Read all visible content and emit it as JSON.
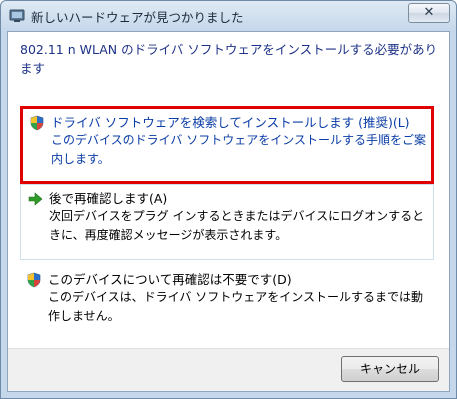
{
  "window": {
    "title": "新しいハードウェアが見つかりました",
    "close_label": "✕"
  },
  "instruction": "802.11 n WLAN のドライバ ソフトウェアをインストールする必要があります",
  "options": [
    {
      "title": "ドライバ ソフトウェアを検索してインストールします (推奨)(L)",
      "description": "このデバイスのドライバ ソフトウェアをインストールする手順をご案内します。",
      "icon": "shield-icon"
    },
    {
      "title": "後で再確認します(A)",
      "description": "次回デバイスをプラグ インするときまたはデバイスにログオンするときに、再度確認メッセージが表示されます。",
      "icon": "green-arrow-icon"
    },
    {
      "title": "このデバイスについて再確認は不要です(D)",
      "description": "このデバイスは、ドライバ ソフトウェアをインストールするまでは動作しません。",
      "icon": "shield-icon"
    }
  ],
  "footer": {
    "cancel_label": "キャンセル"
  },
  "colors": {
    "highlight_border": "#e00000",
    "link_blue": "#0a3ca5",
    "instruction_blue": "#1e3287",
    "arrow_green": "#2e9b28"
  }
}
